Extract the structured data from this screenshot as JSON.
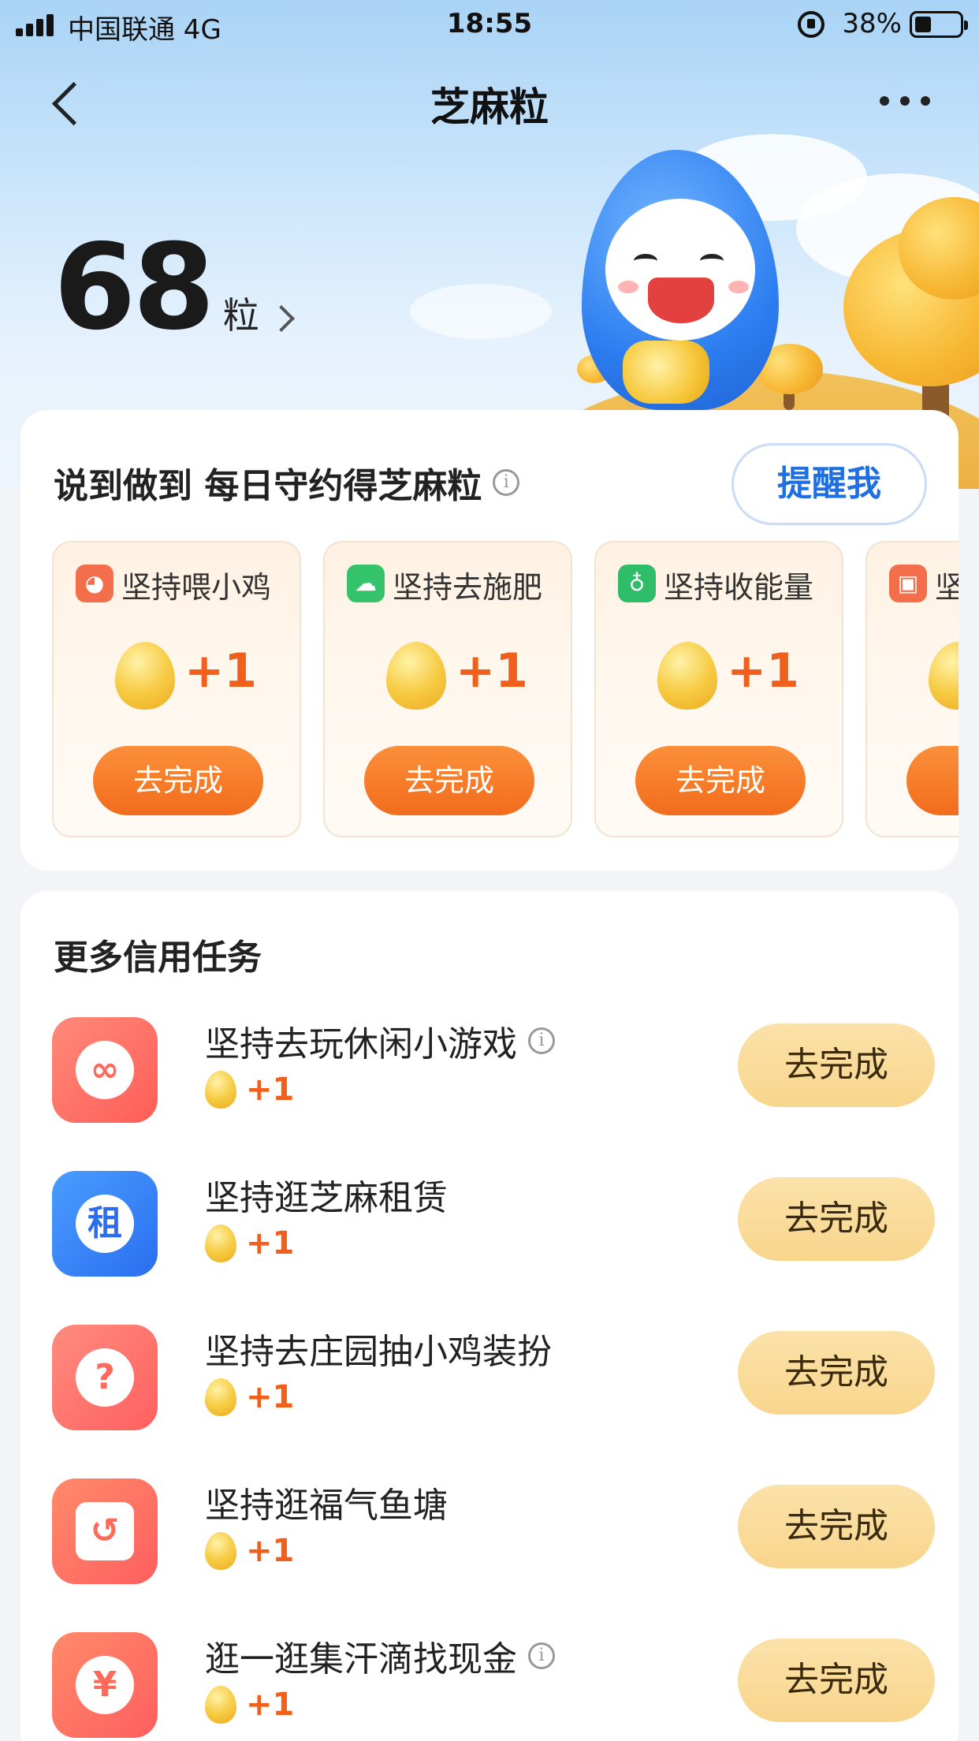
{
  "status_bar": {
    "carrier": "中国联通  4G",
    "time": "18:55",
    "battery": "38%"
  },
  "nav": {
    "title": "芝麻粒"
  },
  "points": {
    "value": "68",
    "unit": "粒"
  },
  "daily": {
    "title": "说到做到 每日守约得芝麻粒",
    "remind_label": "提醒我",
    "tasks": [
      {
        "title": "坚持喂小鸡",
        "reward": "+1",
        "button": "去完成",
        "icon": "chick-icon",
        "color": "#f36f4c"
      },
      {
        "title": "坚持去施肥",
        "reward": "+1",
        "button": "去完成",
        "icon": "farm-icon",
        "color": "#34c26b"
      },
      {
        "title": "坚持收能量",
        "reward": "+1",
        "button": "去完成",
        "icon": "energy-icon",
        "color": "#2fbd6a"
      },
      {
        "title": "坚",
        "reward": "",
        "button": "去",
        "icon": "gift-icon",
        "color": "#f36f4c"
      }
    ]
  },
  "more_tasks": {
    "title": "更多信用任务",
    "items": [
      {
        "title": "坚持去玩休闲小游戏",
        "reward": "+1",
        "button": "去完成",
        "has_info": true,
        "icon": "game-icon",
        "glyph": "∞",
        "colors": [
          "#ff8a7a",
          "#ff5d57"
        ]
      },
      {
        "title": "坚持逛芝麻租赁",
        "reward": "+1",
        "button": "去完成",
        "has_info": false,
        "icon": "rent-icon",
        "glyph": "租",
        "colors": [
          "#4a9dff",
          "#2a6ef0"
        ]
      },
      {
        "title": "坚持去庄园抽小鸡装扮",
        "reward": "+1",
        "button": "去完成",
        "has_info": false,
        "icon": "lottery-icon",
        "glyph": "?",
        "colors": [
          "#ff8c7e",
          "#ff6060"
        ]
      },
      {
        "title": "坚持逛福气鱼塘",
        "reward": "+1",
        "button": "去完成",
        "has_info": false,
        "icon": "fishpond-icon",
        "glyph": "↺",
        "colors": [
          "#ff8a6a",
          "#ff5f5f"
        ]
      },
      {
        "title": "逛一逛集汗滴找现金",
        "reward": "+1",
        "button": "去完成",
        "has_info": true,
        "icon": "cash-icon",
        "glyph": "¥",
        "colors": [
          "#ff8a6a",
          "#ff5f5f"
        ]
      }
    ]
  }
}
